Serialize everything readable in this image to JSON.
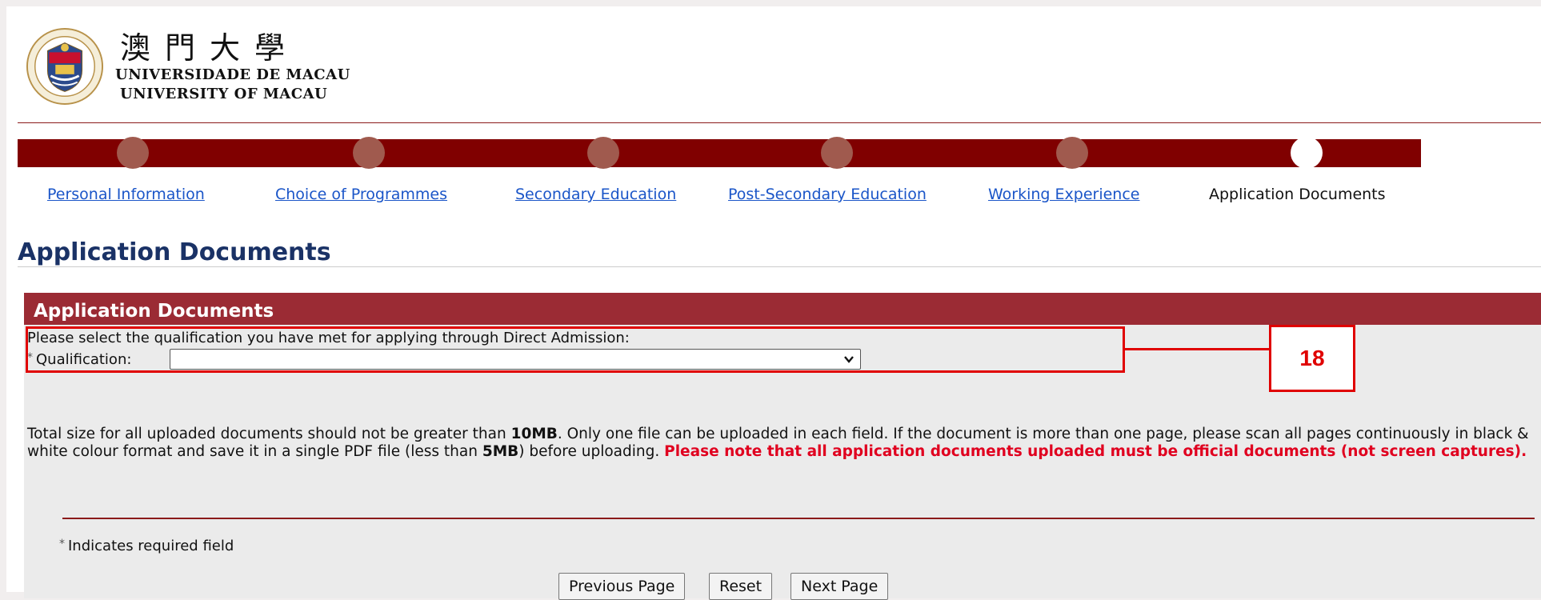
{
  "header": {
    "logo_chinese": "澳門大學",
    "logo_portuguese": "UNIVERSIDADE DE MACAU",
    "logo_english": "UNIVERSITY OF MACAU",
    "seal_text": "UNIVERSIDADE DE MACAU"
  },
  "progress": {
    "steps": [
      {
        "label": "Personal Information",
        "state": "done"
      },
      {
        "label": "Choice of Programmes",
        "state": "done"
      },
      {
        "label": "Secondary Education",
        "state": "done"
      },
      {
        "label": "Post-Secondary Education",
        "state": "done"
      },
      {
        "label": "Working Experience",
        "state": "done"
      },
      {
        "label": "Application Documents",
        "state": "current"
      }
    ],
    "bar_color": "#800000",
    "dot_color": "#a05a4e",
    "current_dot_color": "#ffffff"
  },
  "page_title": "Application Documents",
  "section": {
    "header": "Application Documents",
    "instruction": "Please select the qualification you have met for applying through Direct Admission:",
    "qualification_label": "Qualification:",
    "qualification_value": "",
    "notice_part1": "Total size for all uploaded documents should not be greater than ",
    "notice_size_total": "10MB",
    "notice_part2": ". Only one file can be uploaded in each field. If the document is more than one page, please scan all pages continuously in black & white colour format and save it in a single PDF file (less than ",
    "notice_size_file": "5MB",
    "notice_part3": ") before uploading. ",
    "notice_warning": "Please note that all application documents uploaded must be official documents (not screen captures).",
    "required_note": "Indicates required field"
  },
  "buttons": {
    "previous": "Previous Page",
    "reset": "Reset",
    "next": "Next Page"
  },
  "annotation": {
    "label": "18",
    "color": "#e00000"
  },
  "colors": {
    "title": "#1a3266",
    "section_header": "#9b2b34",
    "link": "#1a55c8",
    "warning": "#e0001f"
  }
}
